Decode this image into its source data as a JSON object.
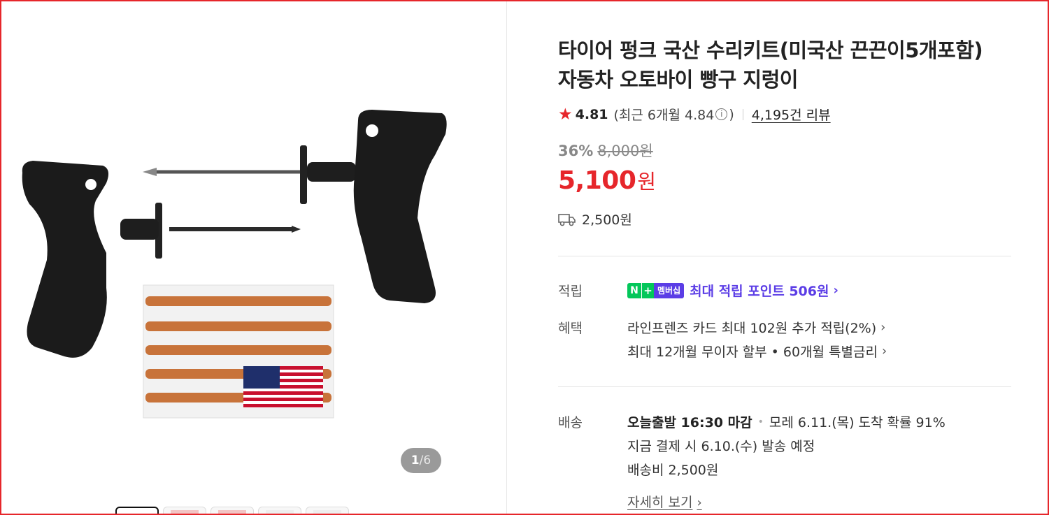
{
  "product": {
    "title_line1": "타이어 펑크 국산 수리키트(미국산 끈끈이5개포함)",
    "title_line2": "자동차 오토바이 빵구 지렁이"
  },
  "rating": {
    "score": "4.81",
    "recent_prefix": "(최근 6개월 4.84",
    "recent_suffix": ")",
    "reviews": "4,195건 리뷰"
  },
  "price": {
    "discount_pct": "36%",
    "original": "8,000원",
    "sale_number": "5,100",
    "sale_unit": "원",
    "shipping_fee": "2,500원"
  },
  "gallery": {
    "current": "1",
    "separator": "/",
    "total": "6",
    "thumb_count": 5
  },
  "details": {
    "points_label": "적립",
    "badge_n": "N",
    "badge_plus": "+",
    "badge_membership": "멤버십",
    "points_text": "최대 적립 포인트 506원",
    "benefit_label": "혜택",
    "benefit_1": "라인프렌즈 카드 최대 102원 추가 적립(2%)",
    "benefit_2": "최대 12개월 무이자 할부 • 60개월 특별금리",
    "delivery_label": "배송",
    "delivery_bold": "오늘출발 16:30 마감",
    "delivery_arrival": "모레 6.11.(목) 도착 확률 91%",
    "delivery_dispatch": "지금 결제 시 6.10.(수) 발송 예정",
    "delivery_fee": "배송비 2,500원",
    "more": "자세히 보기"
  },
  "colors": {
    "accent_red": "#e6262b",
    "naver_green": "#03c75a",
    "membership_purple": "#5b3de6"
  }
}
